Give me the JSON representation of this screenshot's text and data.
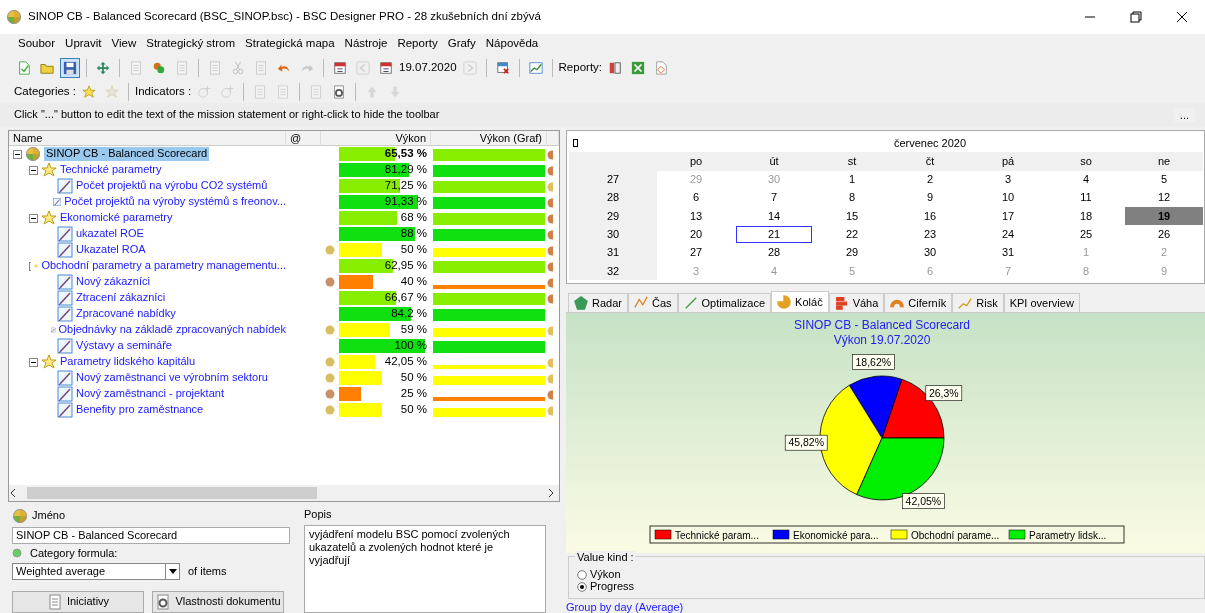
{
  "window": {
    "title": "SINOP CB - Balanced Scorecard (BSC_SINOP.bsc) - BSC Designer PRO - 28 zkušebních dní zbývá"
  },
  "menu": [
    "Soubor",
    "Upravit",
    "View",
    "Strategický strom",
    "Strategická mapa",
    "Nástroje",
    "Reporty",
    "Grafy",
    "Nápověda"
  ],
  "toolbar": [
    {
      "kind": "button",
      "disabled": false,
      "pressed": false
    },
    {
      "kind": "button",
      "disabled": false,
      "pressed": false
    },
    {
      "kind": "button",
      "disabled": false,
      "pressed": true
    },
    {
      "kind": "separator"
    },
    {
      "kind": "button",
      "disabled": false,
      "pressed": false
    },
    {
      "kind": "separator"
    },
    {
      "kind": "button",
      "disabled": true,
      "pressed": false
    },
    {
      "kind": "button",
      "disabled": false,
      "pressed": false
    },
    {
      "kind": "button",
      "disabled": true,
      "pressed": false
    },
    {
      "kind": "separator"
    },
    {
      "kind": "button",
      "disabled": true,
      "pressed": false
    },
    {
      "kind": "button",
      "disabled": true,
      "pressed": false
    },
    {
      "kind": "button",
      "disabled": true,
      "pressed": false
    },
    {
      "kind": "button",
      "disabled": false,
      "pressed": false
    },
    {
      "kind": "button",
      "disabled": true,
      "pressed": false
    },
    {
      "kind": "separator"
    },
    {
      "kind": "button",
      "disabled": false,
      "pressed": false
    },
    {
      "kind": "button",
      "disabled": true,
      "pressed": false
    },
    {
      "kind": "button",
      "disabled": false,
      "pressed": false
    },
    {
      "kind": "text",
      "text": "19.07.2020"
    },
    {
      "kind": "button",
      "disabled": true,
      "pressed": false
    },
    {
      "kind": "separator"
    },
    {
      "kind": "button",
      "disabled": false,
      "pressed": false
    },
    {
      "kind": "separator"
    },
    {
      "kind": "button",
      "disabled": false,
      "pressed": false
    },
    {
      "kind": "separator"
    },
    {
      "kind": "text",
      "text": "Reporty:"
    },
    {
      "kind": "button",
      "disabled": false,
      "pressed": false
    },
    {
      "kind": "button",
      "disabled": false,
      "pressed": false
    },
    {
      "kind": "button",
      "disabled": false,
      "pressed": false
    }
  ],
  "toolbar2": [
    {
      "kind": "text",
      "text": "Categories :"
    },
    {
      "kind": "button",
      "disabled": false
    },
    {
      "kind": "button",
      "disabled": true
    },
    {
      "kind": "separator"
    },
    {
      "kind": "text",
      "text": "Indicators :"
    },
    {
      "kind": "button",
      "disabled": true
    },
    {
      "kind": "button",
      "disabled": true
    },
    {
      "kind": "separator"
    },
    {
      "kind": "button",
      "disabled": true
    },
    {
      "kind": "button",
      "disabled": true
    },
    {
      "kind": "separator"
    },
    {
      "kind": "button",
      "disabled": true
    },
    {
      "kind": "button",
      "disabled": false
    },
    {
      "kind": "separator"
    },
    {
      "kind": "button",
      "disabled": true
    },
    {
      "kind": "button",
      "disabled": true
    }
  ],
  "hint": {
    "text": "Click \"...\" button to edit the text of the mission statement or right-click to hide the toolbar",
    "button": "..."
  },
  "tree": {
    "columns": [
      "Name",
      "@",
      "Výkon",
      "Výkon (Graf)"
    ],
    "rows": [
      {
        "kind": "root",
        "name": "SINOP CB - Balanced Scorecard",
        "selected": true,
        "expanded": true,
        "value": "65,53 %",
        "color": "#88ee00",
        "flag": {
          "color": "#d0804a"
        },
        "children": [
          {
            "kind": "category",
            "name": "Technické parametry",
            "selected": false,
            "expanded": true,
            "value": "81,29 %",
            "color": "#10e010",
            "flag": {
              "color": "#d0804a"
            },
            "children": [
              {
                "kind": "indicator",
                "name": "Počet projektů na výrobu CO2 systémů",
                "selected": false,
                "value": "71,25 %",
                "color": "#88ee00",
                "flag": {
                  "color": "#e0c060"
                }
              },
              {
                "kind": "indicator",
                "name": "Počet projektů na výroby systémů s freonov...",
                "selected": false,
                "value": "91,33 %",
                "color": "#10e010",
                "flag": {
                  "color": "#d0804a"
                }
              }
            ]
          },
          {
            "kind": "category",
            "name": "Ekonomické parametry",
            "selected": false,
            "expanded": true,
            "value": "68 %",
            "color": "#88ee00",
            "flag": {
              "color": "#d0804a"
            },
            "children": [
              {
                "kind": "indicator",
                "name": "ukazatel ROE",
                "selected": false,
                "value": "88 %",
                "color": "#10e010",
                "flag": {
                  "color": "#d0804a"
                }
              },
              {
                "kind": "indicator",
                "name": "Ukazatel ROA",
                "selected": false,
                "value": "50 %",
                "color": "#ffff00",
                "lamp": {
                  "color": "#d8c060"
                },
                "flag": {
                  "color": "#d0804a"
                }
              }
            ]
          },
          {
            "kind": "category",
            "name": "Obchodní parametry a parametry managementu...",
            "selected": false,
            "expanded": true,
            "value": "62,95 %",
            "color": "#88ee00",
            "flag": {
              "color": "#d0804a"
            },
            "children": [
              {
                "kind": "indicator",
                "name": "Nový zákazníci",
                "selected": false,
                "value": "40 %",
                "color": "#ff8000",
                "lamp": {
                  "color": "#c8906a"
                },
                "flag": {
                  "color": "#d0804a"
                }
              },
              {
                "kind": "indicator",
                "name": "Ztracení zákazníci",
                "selected": false,
                "value": "66,67 %",
                "color": "#88ee00",
                "flag": {
                  "color": "#d0804a"
                }
              },
              {
                "kind": "indicator",
                "name": "Zpracované nabídky",
                "selected": false,
                "value": "84,2 %",
                "color": "#10e010"
              },
              {
                "kind": "indicator",
                "name": "Objednávky na základě zpracovaných nabídek",
                "selected": false,
                "value": "59 %",
                "color": "#ffff00",
                "lamp": {
                  "color": "#d8c060"
                },
                "flag": {
                  "color": "#e0c060"
                }
              },
              {
                "kind": "indicator",
                "name": "Výstavy a semináře",
                "selected": false,
                "value": "100 %",
                "color": "#10e010"
              }
            ]
          },
          {
            "kind": "category",
            "name": "Parametry lidského kapitálu",
            "selected": false,
            "expanded": true,
            "value": "42,05 %",
            "color": "#ffff00",
            "lamp": {
              "color": "#d8c060"
            },
            "flag": {
              "color": "#e0c060"
            },
            "children": [
              {
                "kind": "indicator",
                "name": "Nový zaměstnanci ve výrobním sektoru",
                "selected": false,
                "value": "50 %",
                "color": "#ffff00",
                "lamp": {
                  "color": "#d8c060"
                },
                "flag": {
                  "color": "#e0c060"
                }
              },
              {
                "kind": "indicator",
                "name": "Nový zaměstnanci - projektant",
                "selected": false,
                "value": "25 %",
                "color": "#ff8000",
                "lamp": {
                  "color": "#c8906a"
                },
                "flag": {
                  "color": "#d0804a"
                }
              },
              {
                "kind": "indicator",
                "name": "Benefity pro zaměstnance",
                "selected": false,
                "value": "50 %",
                "color": "#ffff00",
                "lamp": {
                  "color": "#d8c060"
                },
                "flag": {
                  "color": "#e0c060"
                }
              }
            ]
          }
        ]
      }
    ]
  },
  "form": {
    "name_label": "Jméno",
    "name_value": "SINOP CB - Balanced Scorecard",
    "formula_label": "Category formula:",
    "formula_value": "Weighted average",
    "formula_suffix": "of items",
    "buttons": [
      "Iniciativy",
      "Vlastnosti dokumentu"
    ],
    "description_label": "Popis",
    "description": "vyjádření modelu BSC pomocí zvolených ukazatelů a zvolených hodnot které je vyjadřují"
  },
  "calendar": {
    "title": "červenec 2020",
    "weekdays": [
      "po",
      "út",
      "st",
      "čt",
      "pá",
      "so",
      "ne"
    ],
    "weeks": [
      {
        "number": "27",
        "days": [
          {
            "d": "29",
            "other": true,
            "selected": false,
            "focused": false
          },
          {
            "d": "30",
            "other": true,
            "selected": false,
            "focused": false
          },
          {
            "d": "1",
            "other": false,
            "selected": false,
            "focused": false
          },
          {
            "d": "2",
            "other": false,
            "selected": false,
            "focused": false
          },
          {
            "d": "3",
            "other": false,
            "selected": false,
            "focused": false
          },
          {
            "d": "4",
            "other": false,
            "selected": false,
            "focused": false
          },
          {
            "d": "5",
            "other": false,
            "selected": false,
            "focused": false
          }
        ]
      },
      {
        "number": "28",
        "days": [
          {
            "d": "6",
            "other": false,
            "selected": false,
            "focused": false
          },
          {
            "d": "7",
            "other": false,
            "selected": false,
            "focused": false
          },
          {
            "d": "8",
            "other": false,
            "selected": false,
            "focused": false
          },
          {
            "d": "9",
            "other": false,
            "selected": false,
            "focused": false
          },
          {
            "d": "10",
            "other": false,
            "selected": false,
            "focused": false
          },
          {
            "d": "11",
            "other": false,
            "selected": false,
            "focused": false
          },
          {
            "d": "12",
            "other": false,
            "selected": false,
            "focused": false
          }
        ]
      },
      {
        "number": "29",
        "days": [
          {
            "d": "13",
            "other": false,
            "selected": false,
            "focused": false
          },
          {
            "d": "14",
            "other": false,
            "selected": false,
            "focused": false
          },
          {
            "d": "15",
            "other": false,
            "selected": false,
            "focused": false
          },
          {
            "d": "16",
            "other": false,
            "selected": false,
            "focused": false
          },
          {
            "d": "17",
            "other": false,
            "selected": false,
            "focused": false
          },
          {
            "d": "18",
            "other": false,
            "selected": false,
            "focused": false
          },
          {
            "d": "19",
            "other": false,
            "selected": true,
            "focused": false
          }
        ]
      },
      {
        "number": "30",
        "days": [
          {
            "d": "20",
            "other": false,
            "selected": false,
            "focused": false
          },
          {
            "d": "21",
            "other": false,
            "selected": false,
            "focused": true
          },
          {
            "d": "22",
            "other": false,
            "selected": false,
            "focused": false
          },
          {
            "d": "23",
            "other": false,
            "selected": false,
            "focused": false
          },
          {
            "d": "24",
            "other": false,
            "selected": false,
            "focused": false
          },
          {
            "d": "25",
            "other": false,
            "selected": false,
            "focused": false
          },
          {
            "d": "26",
            "other": false,
            "selected": false,
            "focused": false
          }
        ]
      },
      {
        "number": "31",
        "days": [
          {
            "d": "27",
            "other": false,
            "selected": false,
            "focused": false
          },
          {
            "d": "28",
            "other": false,
            "selected": false,
            "focused": false
          },
          {
            "d": "29",
            "other": false,
            "selected": false,
            "focused": false
          },
          {
            "d": "30",
            "other": false,
            "selected": false,
            "focused": false
          },
          {
            "d": "31",
            "other": false,
            "selected": false,
            "focused": false
          },
          {
            "d": "1",
            "other": true,
            "selected": false,
            "focused": false
          },
          {
            "d": "2",
            "other": true,
            "selected": false,
            "focused": false
          }
        ]
      },
      {
        "number": "32",
        "days": [
          {
            "d": "3",
            "other": true,
            "selected": false,
            "focused": false
          },
          {
            "d": "4",
            "other": true,
            "selected": false,
            "focused": false
          },
          {
            "d": "5",
            "other": true,
            "selected": false,
            "focused": false
          },
          {
            "d": "6",
            "other": true,
            "selected": false,
            "focused": false
          },
          {
            "d": "7",
            "other": true,
            "selected": false,
            "focused": false
          },
          {
            "d": "8",
            "other": true,
            "selected": false,
            "focused": false
          },
          {
            "d": "9",
            "other": true,
            "selected": false,
            "focused": false
          }
        ]
      }
    ]
  },
  "chart_tabs": [
    {
      "label": "Radar",
      "selected": false
    },
    {
      "label": "Čas",
      "selected": false
    },
    {
      "label": "Optimalizace",
      "selected": false
    },
    {
      "label": "Koláč",
      "selected": true
    },
    {
      "label": "Váha",
      "selected": false
    },
    {
      "label": "Ciferník",
      "selected": false
    },
    {
      "label": "Risk",
      "selected": false
    },
    {
      "label": "KPI overview",
      "selected": false
    }
  ],
  "chart": {
    "chart_data": {
      "type": "pie",
      "title": "SINOP CB - Balanced Scorecard\nVýkon 19.07.2020",
      "categories": [
        "Technické param...",
        "Ekonomické para...",
        "Obchodní parame...",
        "Parametry lidsk..."
      ],
      "values": [
        26.3,
        18.62,
        45.82,
        42.05
      ],
      "colors": [
        "#ff0000",
        "#0000ff",
        "#ffff00",
        "#00ee00"
      ],
      "value_labels": [
        "26,3%",
        "18,62%",
        "45,82%",
        "42,05%"
      ],
      "legend": "bottom"
    }
  },
  "value_kind": {
    "label": "Value kind :",
    "options": [
      {
        "label": "Výkon",
        "selected": false
      },
      {
        "label": "Progress",
        "selected": true
      }
    ]
  },
  "status_bar": "Group by day (Average)"
}
